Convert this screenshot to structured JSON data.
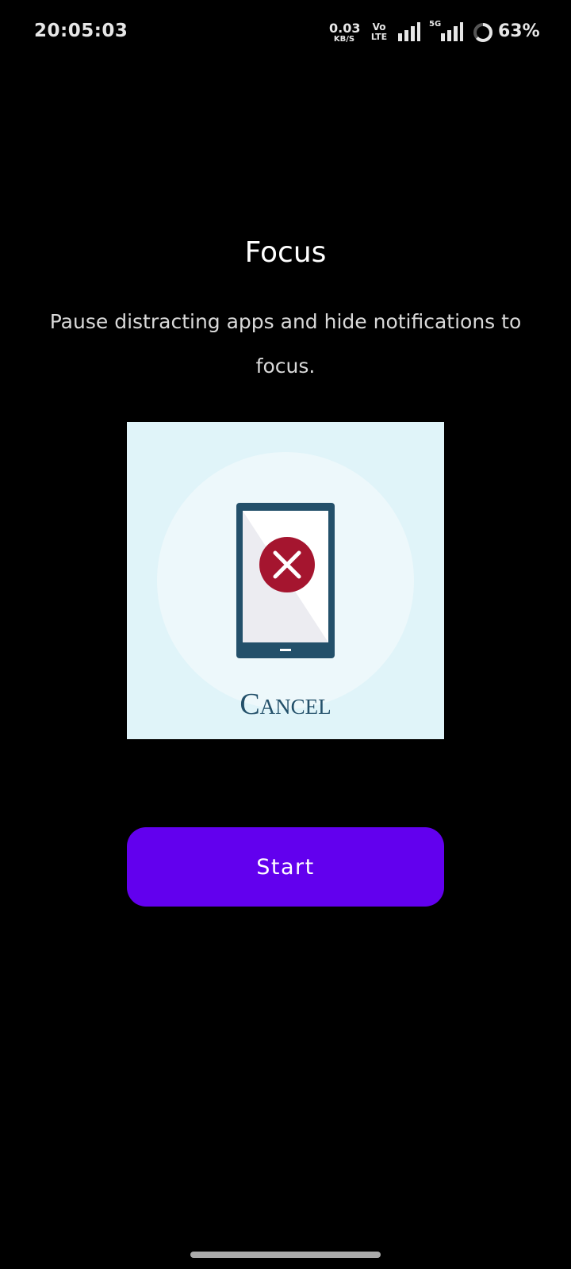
{
  "status_bar": {
    "time": "20:05:03",
    "net_speed_value": "0.03",
    "net_speed_unit": "KB/S",
    "volte_top": "Vo",
    "volte_bottom": "LTE",
    "network_type": "5G",
    "battery_percent": "63%",
    "icons": [
      "signal-bars-icon",
      "signal-bars-icon",
      "battery-ring-icon"
    ]
  },
  "main": {
    "title": "Focus",
    "description": "Pause distracting apps and hide notifications to focus.",
    "illustration": {
      "caption": "Cancel",
      "icon": "phone-cancel-icon",
      "background_color": "#e0f4f9",
      "accent_color": "#a5152f",
      "device_color": "#23506a"
    },
    "start_label": "Start",
    "start_color": "#6200ee"
  }
}
